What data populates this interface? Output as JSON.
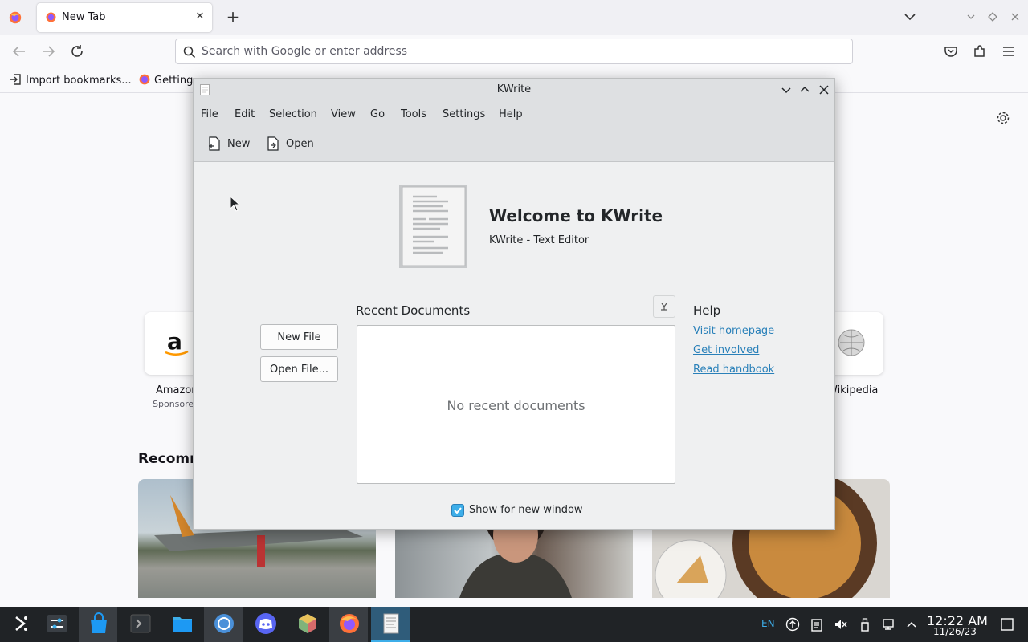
{
  "browser": {
    "tab": {
      "title": "New Tab"
    },
    "url_placeholder": "Search with Google or enter address",
    "bookmarks": [
      {
        "label": "Import bookmarks..."
      },
      {
        "label": "Getting"
      }
    ],
    "shortcuts": [
      {
        "label": "Amazon",
        "sub": "Sponsored"
      },
      {
        "label": "Wikipedia"
      }
    ],
    "recommended_heading": "Recommended"
  },
  "kwrite": {
    "window_title": "KWrite",
    "menu": [
      "File",
      "Edit",
      "Selection",
      "View",
      "Go",
      "Tools",
      "Settings",
      "Help"
    ],
    "toolbar": {
      "new_label": "New",
      "open_label": "Open"
    },
    "welcome_title": "Welcome to KWrite",
    "welcome_subtitle": "KWrite - Text Editor",
    "new_file_button": "New File",
    "open_file_button": "Open File...",
    "recent_title": "Recent Documents",
    "recent_empty": "No recent documents",
    "help_title": "Help",
    "help_links": [
      "Visit homepage",
      "Get involved",
      "Read handbook"
    ],
    "show_for_new_window": {
      "label": "Show for new window",
      "checked": true
    }
  },
  "taskbar": {
    "language": "EN",
    "time": "12:22 AM",
    "date": "11/26/23"
  },
  "colors": {
    "accent": "#3daee9",
    "link": "#2980b9",
    "taskbar_bg": "#202326"
  }
}
